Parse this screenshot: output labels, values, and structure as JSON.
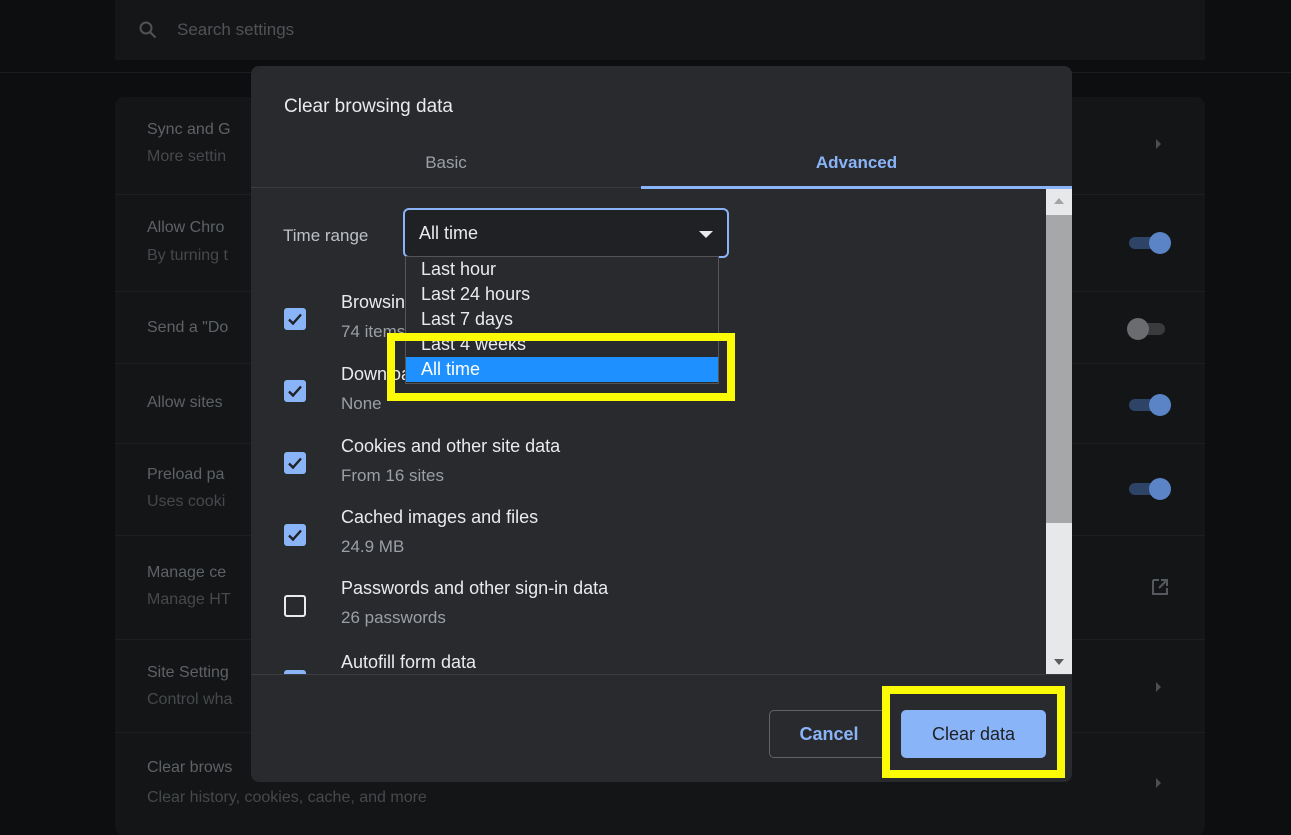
{
  "search": {
    "placeholder": "Search settings"
  },
  "background_rows": [
    {
      "title": "Sync and G",
      "subtitle": "More settin"
    },
    {
      "title": "Allow Chro",
      "subtitle": "By turning t"
    },
    {
      "title": "Send a \"Do",
      "subtitle": ""
    },
    {
      "title": "Allow sites",
      "subtitle": ""
    },
    {
      "title": "Preload pa",
      "subtitle": "Uses cooki"
    },
    {
      "title": "Manage ce",
      "subtitle": "Manage HT"
    },
    {
      "title": "Site Setting",
      "subtitle": "Control wha"
    },
    {
      "title": "Clear brows",
      "subtitle": "Clear history, cookies, cache, and more"
    }
  ],
  "dialog": {
    "title": "Clear browsing data",
    "tabs": [
      {
        "label": "Basic",
        "active": false
      },
      {
        "label": "Advanced",
        "active": true
      }
    ],
    "time_range": {
      "label": "Time range",
      "selected": "All time",
      "options": [
        "Last hour",
        "Last 24 hours",
        "Last 7 days",
        "Last 4 weeks",
        "All time"
      ],
      "highlighted": "All time"
    },
    "items": [
      {
        "title": "Browsing history",
        "subtitle": "74 items",
        "checked": true
      },
      {
        "title": "Download history",
        "subtitle": "None",
        "checked": true
      },
      {
        "title": "Cookies and other site data",
        "subtitle": "From 16 sites",
        "checked": true
      },
      {
        "title": "Cached images and files",
        "subtitle": "24.9 MB",
        "checked": true
      },
      {
        "title": "Passwords and other sign-in data",
        "subtitle": "26 passwords",
        "checked": false
      },
      {
        "title": "Autofill form data",
        "subtitle": "",
        "checked": true
      }
    ],
    "buttons": {
      "cancel": "Cancel",
      "clear": "Clear data"
    }
  },
  "colors": {
    "accent": "#8ab4f8",
    "dialog_bg": "#292a2d",
    "highlight": "#fbfb05",
    "dropdown_selected": "#1e90ff"
  }
}
